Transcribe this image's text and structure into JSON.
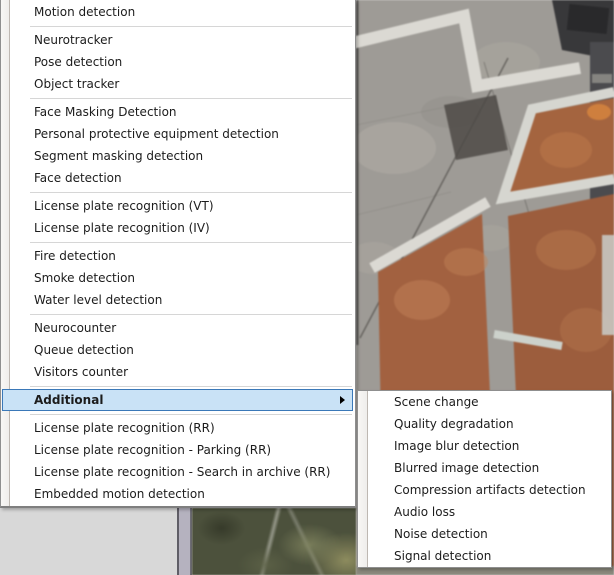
{
  "menu": {
    "items": [
      "Motion detection",
      "Neurotracker",
      "Pose detection",
      "Object tracker",
      "Face Masking Detection",
      "Personal protective equipment detection",
      "Segment masking detection",
      "Face detection",
      "License plate recognition (VT)",
      "License plate recognition (IV)",
      "Fire detection",
      "Smoke detection",
      "Water level detection",
      "Neurocounter",
      "Queue detection",
      "Visitors counter",
      "Additional",
      "License plate recognition (RR)",
      "License plate recognition - Parking (RR)",
      "License plate recognition - Search in archive (RR)",
      "Embedded motion detection"
    ],
    "highlighted_item": "Additional"
  },
  "submenu": {
    "items": [
      "Scene change",
      "Quality degradation",
      "Image blur detection",
      "Blurred image detection",
      "Compression artifacts detection",
      "Audio loss",
      "Noise detection",
      "Signal detection"
    ]
  },
  "colors": {
    "highlight_bg": "#c9e2f6",
    "highlight_border": "#3a78b8",
    "menu_bg": "#ffffff",
    "menu_border": "#8f8f8f",
    "separator": "#d6d6d6",
    "text": "#1c1c1c",
    "panel_bg": "#d8d8d8",
    "scrollbar_track": "#b5b2bf"
  }
}
